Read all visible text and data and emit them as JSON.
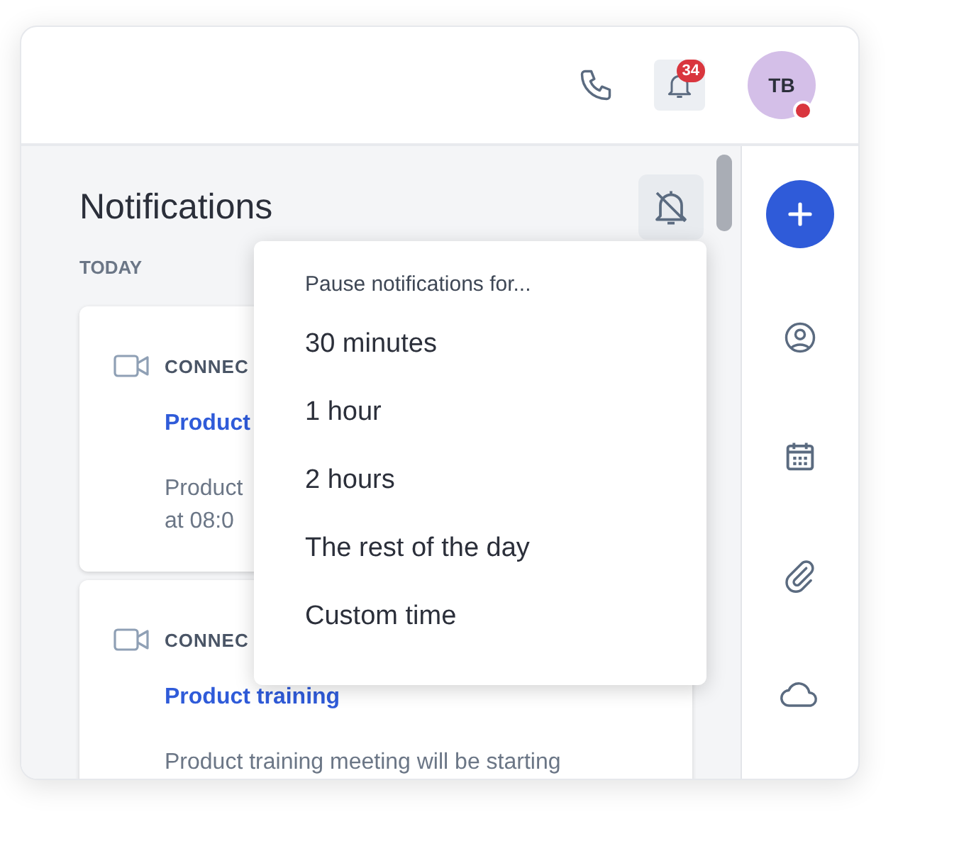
{
  "topbar": {
    "notification_count": "34",
    "avatar_initials": "TB"
  },
  "notifications": {
    "title": "Notifications",
    "section": "TODAY",
    "cards": [
      {
        "source": "CONNEC",
        "title": "Product",
        "description_lines": [
          "Product",
          "at 08:0"
        ]
      },
      {
        "source": "CONNEC",
        "title": "Product training",
        "description_lines": [
          "Product training meeting will be starting"
        ]
      }
    ]
  },
  "pause_menu": {
    "header": "Pause notifications for...",
    "items": [
      {
        "label": "30 minutes"
      },
      {
        "label": "1 hour"
      },
      {
        "label": "2 hours"
      },
      {
        "label": "The rest of the day"
      },
      {
        "label": "Custom time"
      }
    ]
  }
}
